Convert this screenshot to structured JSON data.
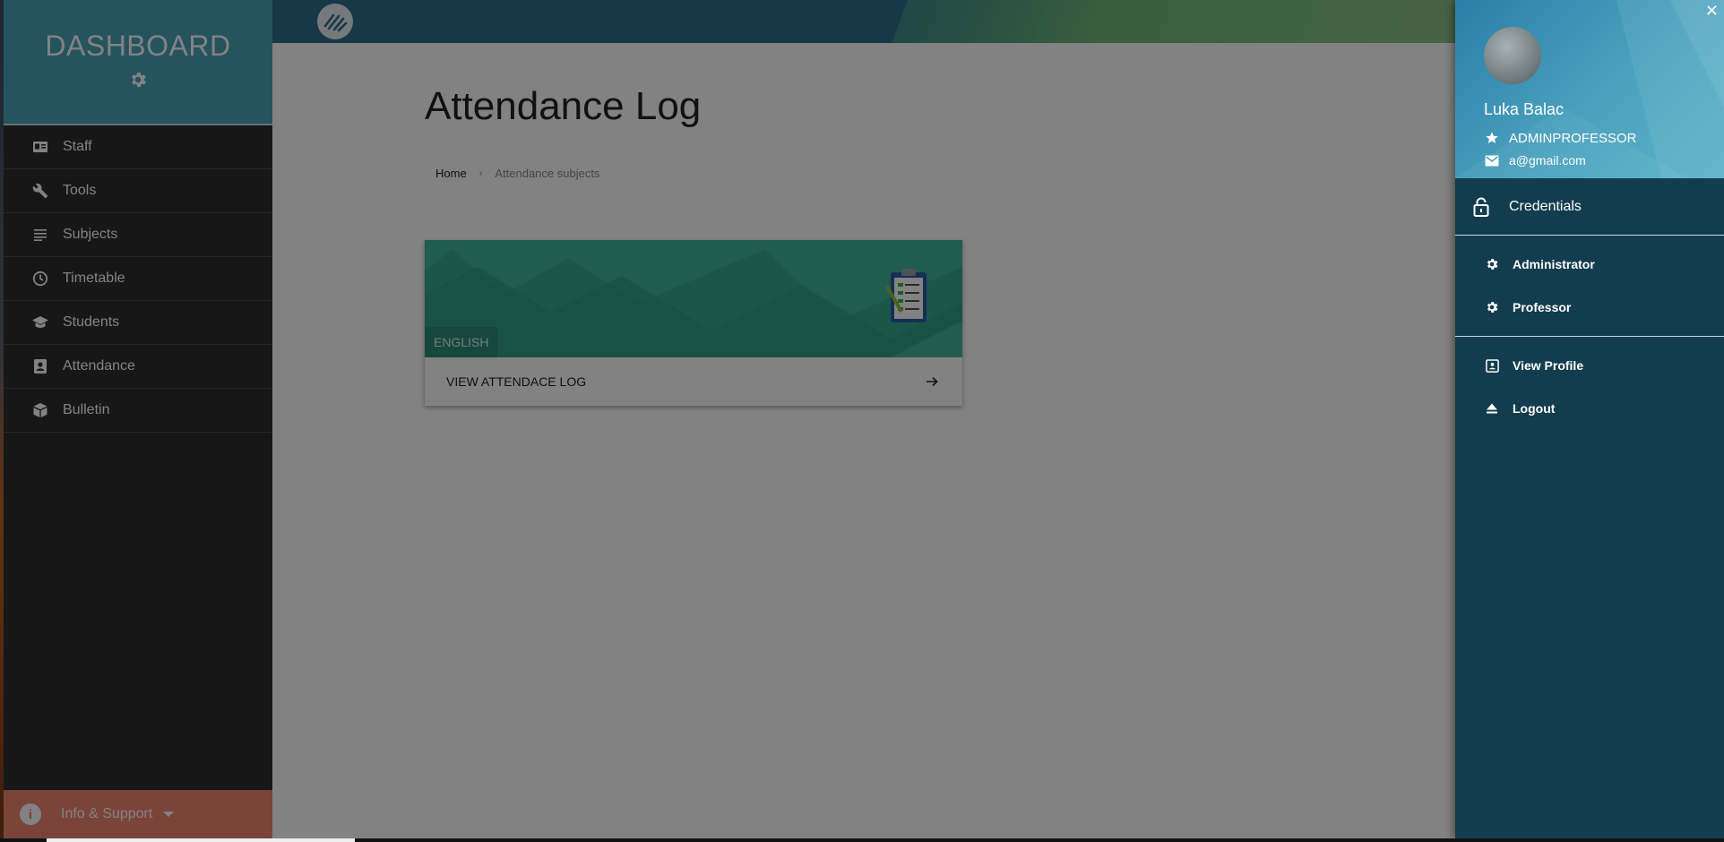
{
  "sidebar": {
    "title": "DASHBOARD",
    "items": [
      {
        "label": "Staff",
        "icon": "staff-card-icon"
      },
      {
        "label": "Tools",
        "icon": "wrench-icon"
      },
      {
        "label": "Subjects",
        "icon": "list-icon"
      },
      {
        "label": "Timetable",
        "icon": "clock-icon"
      },
      {
        "label": "Students",
        "icon": "graduation-cap-icon"
      },
      {
        "label": "Attendance",
        "icon": "contact-card-icon"
      },
      {
        "label": "Bulletin",
        "icon": "box-icon"
      }
    ],
    "support_label": "Info & Support"
  },
  "main": {
    "page_title": "Attendance Log",
    "breadcrumb": {
      "home": "Home",
      "current": "Attendance subjects"
    },
    "card": {
      "tag": "ENGLISH",
      "action_label": "VIEW ATTENDACE LOG"
    }
  },
  "drawer": {
    "user_name": "Luka Balac",
    "role": "ADMINPROFESSOR",
    "email": "a@gmail.com",
    "credentials_label": "Credentials",
    "roles": [
      {
        "label": "Administrator",
        "icon": "gear-icon"
      },
      {
        "label": "Professor",
        "icon": "gear-icon"
      }
    ],
    "actions": [
      {
        "label": "View Profile",
        "icon": "profile-icon"
      },
      {
        "label": "Logout",
        "icon": "eject-icon"
      }
    ],
    "close_label": "✕"
  },
  "colors": {
    "sidebar_header": "#4aa4b8",
    "sidebar_bg": "#2d2d2d",
    "support_bg": "#f08675",
    "drawer_bg": "#133d4e",
    "card_banner": "#3fb59b"
  }
}
